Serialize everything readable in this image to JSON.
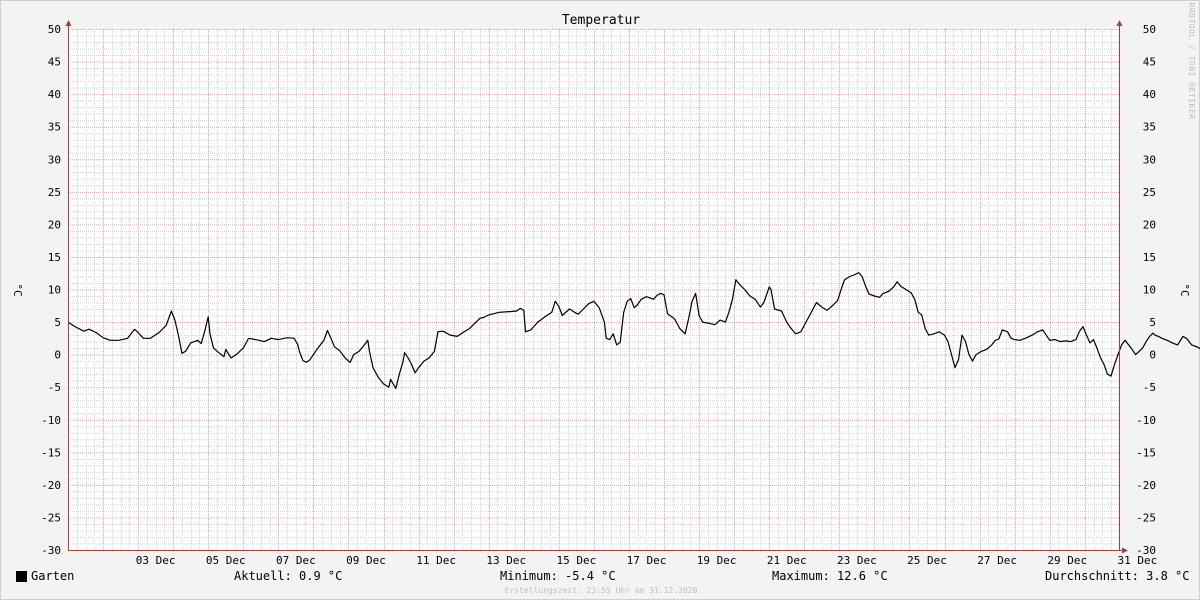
{
  "chart_data": {
    "type": "line",
    "title": "Temperatur",
    "ylabel": "°C",
    "ylabel_right": "°C",
    "ylim": [
      -30,
      50
    ],
    "y_ticks": [
      50,
      45,
      40,
      35,
      30,
      25,
      20,
      15,
      10,
      5,
      0,
      -5,
      -10,
      -15,
      -20,
      -25,
      -30
    ],
    "x_range": [
      1,
      32
    ],
    "x_ticks": [
      {
        "day": 3,
        "label": "03 Dec"
      },
      {
        "day": 5,
        "label": "05 Dec"
      },
      {
        "day": 7,
        "label": "07 Dec"
      },
      {
        "day": 9,
        "label": "09 Dec"
      },
      {
        "day": 11,
        "label": "11 Dec"
      },
      {
        "day": 13,
        "label": "13 Dec"
      },
      {
        "day": 15,
        "label": "15 Dec"
      },
      {
        "day": 17,
        "label": "17 Dec"
      },
      {
        "day": 19,
        "label": "19 Dec"
      },
      {
        "day": 21,
        "label": "21 Dec"
      },
      {
        "day": 23,
        "label": "23 Dec"
      },
      {
        "day": 25,
        "label": "25 Dec"
      },
      {
        "day": 27,
        "label": "27 Dec"
      },
      {
        "day": 29,
        "label": "29 Dec"
      },
      {
        "day": 31,
        "label": "31 Dec"
      }
    ],
    "grid": true,
    "series": [
      {
        "name": "Garten",
        "color": "#000000",
        "points": [
          [
            1.0,
            5.0
          ],
          [
            1.2,
            4.3
          ],
          [
            1.45,
            3.6
          ],
          [
            1.6,
            3.9
          ],
          [
            1.8,
            3.4
          ],
          [
            2.0,
            2.6
          ],
          [
            2.2,
            2.2
          ],
          [
            2.45,
            2.2
          ],
          [
            2.7,
            2.5
          ],
          [
            2.9,
            3.9
          ],
          [
            3.0,
            3.4
          ],
          [
            3.15,
            2.5
          ],
          [
            3.35,
            2.5
          ],
          [
            3.6,
            3.4
          ],
          [
            3.8,
            4.5
          ],
          [
            3.95,
            6.7
          ],
          [
            4.05,
            5.3
          ],
          [
            4.15,
            3.0
          ],
          [
            4.25,
            0.2
          ],
          [
            4.35,
            0.5
          ],
          [
            4.5,
            1.8
          ],
          [
            4.7,
            2.2
          ],
          [
            4.8,
            1.7
          ],
          [
            4.9,
            3.6
          ],
          [
            5.0,
            5.8
          ],
          [
            5.05,
            3.2
          ],
          [
            5.15,
            1.0
          ],
          [
            5.3,
            0.3
          ],
          [
            5.45,
            -0.3
          ],
          [
            5.5,
            0.8
          ],
          [
            5.65,
            -0.5
          ],
          [
            5.8,
            0.0
          ],
          [
            6.0,
            1.0
          ],
          [
            6.15,
            2.5
          ],
          [
            6.35,
            2.3
          ],
          [
            6.6,
            2.0
          ],
          [
            6.8,
            2.5
          ],
          [
            7.0,
            2.3
          ],
          [
            7.25,
            2.6
          ],
          [
            7.45,
            2.5
          ],
          [
            7.55,
            1.6
          ],
          [
            7.6,
            0.5
          ],
          [
            7.7,
            -0.9
          ],
          [
            7.8,
            -1.2
          ],
          [
            7.9,
            -0.8
          ],
          [
            8.1,
            0.8
          ],
          [
            8.3,
            2.2
          ],
          [
            8.4,
            3.7
          ],
          [
            8.5,
            2.5
          ],
          [
            8.6,
            1.2
          ],
          [
            8.75,
            0.6
          ],
          [
            8.9,
            -0.5
          ],
          [
            9.05,
            -1.2
          ],
          [
            9.15,
            0.0
          ],
          [
            9.3,
            0.5
          ],
          [
            9.45,
            1.5
          ],
          [
            9.55,
            2.2
          ],
          [
            9.6,
            0.5
          ],
          [
            9.7,
            -2.0
          ],
          [
            9.85,
            -3.5
          ],
          [
            10.0,
            -4.5
          ],
          [
            10.15,
            -5.0
          ],
          [
            10.2,
            -3.8
          ],
          [
            10.35,
            -5.2
          ],
          [
            10.45,
            -3.0
          ],
          [
            10.55,
            -1.2
          ],
          [
            10.6,
            0.3
          ],
          [
            10.7,
            -0.5
          ],
          [
            10.8,
            -1.5
          ],
          [
            10.9,
            -2.8
          ],
          [
            11.0,
            -2.0
          ],
          [
            11.15,
            -1.0
          ],
          [
            11.3,
            -0.5
          ],
          [
            11.45,
            0.5
          ],
          [
            11.55,
            3.5
          ],
          [
            11.7,
            3.6
          ],
          [
            11.9,
            3.0
          ],
          [
            12.1,
            2.8
          ],
          [
            12.3,
            3.5
          ],
          [
            12.45,
            4.0
          ],
          [
            12.6,
            4.8
          ],
          [
            12.75,
            5.6
          ],
          [
            12.85,
            5.7
          ],
          [
            13.0,
            6.1
          ],
          [
            13.3,
            6.5
          ],
          [
            13.6,
            6.6
          ],
          [
            13.8,
            6.7
          ],
          [
            13.9,
            7.1
          ],
          [
            14.0,
            6.8
          ],
          [
            14.05,
            3.5
          ],
          [
            14.2,
            3.8
          ],
          [
            14.4,
            5.0
          ],
          [
            14.6,
            5.8
          ],
          [
            14.8,
            6.5
          ],
          [
            14.9,
            8.2
          ],
          [
            15.0,
            7.4
          ],
          [
            15.1,
            6.0
          ],
          [
            15.3,
            7.0
          ],
          [
            15.45,
            6.5
          ],
          [
            15.55,
            6.2
          ],
          [
            15.7,
            7.0
          ],
          [
            15.85,
            7.8
          ],
          [
            16.0,
            8.2
          ],
          [
            16.15,
            7.2
          ],
          [
            16.3,
            5.0
          ],
          [
            16.35,
            2.5
          ],
          [
            16.45,
            2.3
          ],
          [
            16.55,
            3.2
          ],
          [
            16.65,
            1.5
          ],
          [
            16.75,
            1.9
          ],
          [
            16.85,
            6.5
          ],
          [
            16.95,
            8.2
          ],
          [
            17.05,
            8.6
          ],
          [
            17.15,
            7.2
          ],
          [
            17.25,
            7.7
          ],
          [
            17.35,
            8.5
          ],
          [
            17.5,
            8.9
          ],
          [
            17.7,
            8.5
          ],
          [
            17.8,
            9.1
          ],
          [
            17.9,
            9.4
          ],
          [
            18.0,
            9.2
          ],
          [
            18.1,
            6.3
          ],
          [
            18.3,
            5.5
          ],
          [
            18.45,
            4.0
          ],
          [
            18.6,
            3.2
          ],
          [
            18.7,
            5.5
          ],
          [
            18.8,
            8.2
          ],
          [
            18.9,
            9.4
          ],
          [
            19.0,
            6.0
          ],
          [
            19.1,
            5.0
          ],
          [
            19.3,
            4.8
          ],
          [
            19.45,
            4.6
          ],
          [
            19.6,
            5.3
          ],
          [
            19.75,
            5.0
          ],
          [
            19.85,
            6.5
          ],
          [
            19.95,
            8.5
          ],
          [
            20.05,
            11.5
          ],
          [
            20.15,
            10.8
          ],
          [
            20.3,
            10.0
          ],
          [
            20.45,
            9.0
          ],
          [
            20.6,
            8.5
          ],
          [
            20.75,
            7.3
          ],
          [
            20.85,
            8.0
          ],
          [
            21.0,
            10.4
          ],
          [
            21.05,
            10.0
          ],
          [
            21.15,
            7.0
          ],
          [
            21.35,
            6.7
          ],
          [
            21.5,
            5.0
          ],
          [
            21.6,
            4.2
          ],
          [
            21.75,
            3.2
          ],
          [
            21.9,
            3.5
          ],
          [
            22.05,
            5.0
          ],
          [
            22.2,
            6.5
          ],
          [
            22.35,
            8.0
          ],
          [
            22.5,
            7.3
          ],
          [
            22.65,
            6.8
          ],
          [
            22.8,
            7.5
          ],
          [
            22.95,
            8.3
          ],
          [
            23.05,
            10.0
          ],
          [
            23.15,
            11.5
          ],
          [
            23.3,
            12.0
          ],
          [
            23.45,
            12.3
          ],
          [
            23.55,
            12.6
          ],
          [
            23.65,
            12.0
          ],
          [
            23.75,
            10.5
          ],
          [
            23.85,
            9.3
          ],
          [
            24.0,
            9.0
          ],
          [
            24.15,
            8.8
          ],
          [
            24.25,
            9.4
          ],
          [
            24.4,
            9.7
          ],
          [
            24.55,
            10.4
          ],
          [
            24.65,
            11.2
          ],
          [
            24.75,
            10.5
          ],
          [
            24.9,
            10.0
          ],
          [
            25.05,
            9.5
          ],
          [
            25.15,
            8.5
          ],
          [
            25.25,
            6.5
          ],
          [
            25.35,
            6.1
          ],
          [
            25.45,
            4.0
          ],
          [
            25.55,
            3.0
          ],
          [
            25.7,
            3.2
          ],
          [
            25.85,
            3.5
          ],
          [
            26.0,
            3.0
          ],
          [
            26.1,
            2.0
          ],
          [
            26.2,
            0.0
          ],
          [
            26.3,
            -2.0
          ],
          [
            26.4,
            -0.8
          ],
          [
            26.5,
            3.0
          ],
          [
            26.6,
            2.0
          ],
          [
            26.7,
            0.0
          ],
          [
            26.8,
            -1.0
          ],
          [
            26.9,
            0.0
          ],
          [
            27.05,
            0.5
          ],
          [
            27.2,
            0.8
          ],
          [
            27.35,
            1.5
          ],
          [
            27.45,
            2.2
          ],
          [
            27.55,
            2.4
          ],
          [
            27.65,
            3.8
          ],
          [
            27.8,
            3.5
          ],
          [
            27.9,
            2.5
          ],
          [
            28.0,
            2.3
          ],
          [
            28.15,
            2.2
          ],
          [
            28.35,
            2.6
          ],
          [
            28.5,
            3.0
          ],
          [
            28.65,
            3.5
          ],
          [
            28.8,
            3.8
          ],
          [
            28.9,
            3.0
          ],
          [
            29.0,
            2.2
          ],
          [
            29.15,
            2.3
          ],
          [
            29.3,
            2.0
          ],
          [
            29.45,
            2.1
          ],
          [
            29.6,
            2.0
          ],
          [
            29.75,
            2.3
          ],
          [
            29.85,
            3.6
          ],
          [
            29.95,
            4.3
          ],
          [
            30.05,
            3.0
          ],
          [
            30.15,
            1.8
          ],
          [
            30.25,
            2.3
          ],
          [
            30.35,
            1.0
          ],
          [
            30.45,
            -0.5
          ],
          [
            30.55,
            -1.5
          ],
          [
            30.65,
            -3.0
          ],
          [
            30.75,
            -3.3
          ],
          [
            30.85,
            -1.5
          ],
          [
            30.95,
            0.0
          ],
          [
            31.05,
            1.5
          ],
          [
            31.15,
            2.2
          ],
          [
            31.25,
            1.5
          ],
          [
            31.35,
            0.8
          ],
          [
            31.45,
            0.0
          ],
          [
            31.55,
            0.5
          ],
          [
            31.65,
            1.0
          ],
          [
            31.75,
            2.0
          ],
          [
            31.85,
            2.8
          ],
          [
            31.95,
            3.3
          ],
          [
            32.0,
            3.0
          ],
          [
            32.1,
            2.8
          ],
          [
            32.2,
            2.5
          ],
          [
            32.35,
            2.2
          ],
          [
            32.5,
            1.8
          ],
          [
            32.65,
            1.5
          ],
          [
            32.8,
            2.8
          ],
          [
            32.9,
            2.5
          ],
          [
            33.05,
            1.5
          ],
          [
            33.2,
            1.2
          ],
          [
            33.3,
            0.9
          ]
        ]
      }
    ]
  },
  "legend": {
    "series_name": "Garten",
    "current": "Aktuell: 0.9 °C",
    "minimum": "Minimum: -5.4 °C",
    "maximum": "Maximum: 12.6 °C",
    "average": "Durchschnitt: 3.8 °C"
  },
  "footer": "Erstellungszeit: 23:55 Uhr am 31.12.2020",
  "watermark": "RRDTOOL / TOBI OETIKER",
  "colors": {
    "plot_background": "#ffffff",
    "canvas_background": "#f3f3f3",
    "major_grid": "#e3a3a3",
    "minor_grid": "#d4d4d4",
    "axis": "#a04040",
    "line": "#000000"
  }
}
